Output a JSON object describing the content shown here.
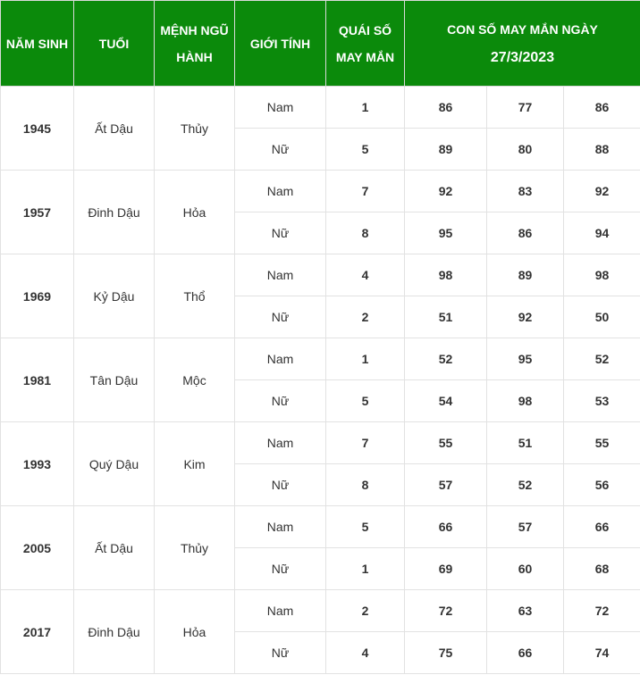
{
  "header": {
    "nam_sinh": "NĂM SINH",
    "tuoi": "TUỔI",
    "menh_line1": "MỆNH NGŨ",
    "menh_line2": "HÀNH",
    "gioi_tinh": "GIỚI TÍNH",
    "quai_line1": "QUÁI SỐ",
    "quai_line2": "MAY MẮN",
    "lucky_title": "CON SỐ MAY MẮN NGÀY",
    "lucky_date": "27/3/2023"
  },
  "colors": {
    "header_bg": "#0b8a0b",
    "header_text": "#ffffff",
    "quai_number": "#e60000"
  },
  "rows": [
    {
      "year": "1945",
      "tuoi": "Ất Dậu",
      "menh": "Thủy",
      "genders": [
        {
          "gender": "Nam",
          "quai": "1",
          "numbers": [
            "86",
            "77",
            "86"
          ]
        },
        {
          "gender": "Nữ",
          "quai": "5",
          "numbers": [
            "89",
            "80",
            "88"
          ]
        }
      ]
    },
    {
      "year": "1957",
      "tuoi": "Đinh Dậu",
      "menh": "Hỏa",
      "genders": [
        {
          "gender": "Nam",
          "quai": "7",
          "numbers": [
            "92",
            "83",
            "92"
          ]
        },
        {
          "gender": "Nữ",
          "quai": "8",
          "numbers": [
            "95",
            "86",
            "94"
          ]
        }
      ]
    },
    {
      "year": "1969",
      "tuoi": "Kỷ Dậu",
      "menh": "Thổ",
      "genders": [
        {
          "gender": "Nam",
          "quai": "4",
          "numbers": [
            "98",
            "89",
            "98"
          ]
        },
        {
          "gender": "Nữ",
          "quai": "2",
          "numbers": [
            "51",
            "92",
            "50"
          ]
        }
      ]
    },
    {
      "year": "1981",
      "tuoi": "Tân Dậu",
      "menh": "Mộc",
      "genders": [
        {
          "gender": "Nam",
          "quai": "1",
          "numbers": [
            "52",
            "95",
            "52"
          ]
        },
        {
          "gender": "Nữ",
          "quai": "5",
          "numbers": [
            "54",
            "98",
            "53"
          ]
        }
      ]
    },
    {
      "year": "1993",
      "tuoi": "Quý Dậu",
      "menh": "Kim",
      "genders": [
        {
          "gender": "Nam",
          "quai": "7",
          "numbers": [
            "55",
            "51",
            "55"
          ]
        },
        {
          "gender": "Nữ",
          "quai": "8",
          "numbers": [
            "57",
            "52",
            "56"
          ]
        }
      ]
    },
    {
      "year": "2005",
      "tuoi": "Ất Dậu",
      "menh": "Thủy",
      "genders": [
        {
          "gender": "Nam",
          "quai": "5",
          "numbers": [
            "66",
            "57",
            "66"
          ]
        },
        {
          "gender": "Nữ",
          "quai": "1",
          "numbers": [
            "69",
            "60",
            "68"
          ]
        }
      ]
    },
    {
      "year": "2017",
      "tuoi": "Đinh Dậu",
      "menh": "Hỏa",
      "genders": [
        {
          "gender": "Nam",
          "quai": "2",
          "numbers": [
            "72",
            "63",
            "72"
          ]
        },
        {
          "gender": "Nữ",
          "quai": "4",
          "numbers": [
            "75",
            "66",
            "74"
          ]
        }
      ]
    }
  ]
}
